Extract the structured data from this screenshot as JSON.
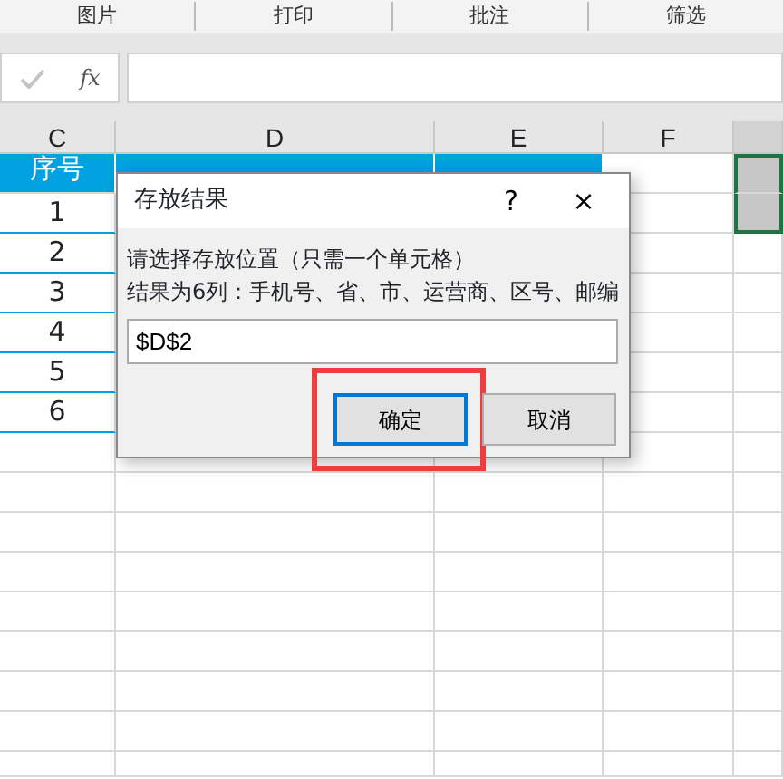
{
  "ribbon": [
    {
      "label": "图片"
    },
    {
      "label": "打印"
    },
    {
      "label": "批注"
    },
    {
      "label": "筛选"
    }
  ],
  "formula_bar": {
    "fx": "fx"
  },
  "columns": [
    {
      "label": "C",
      "selected": false
    },
    {
      "label": "D",
      "selected": false
    },
    {
      "label": "E",
      "selected": false
    },
    {
      "label": "F",
      "selected": false
    },
    {
      "selected": true
    }
  ],
  "rows": [
    {
      "kind": "header",
      "cells": [
        "序号"
      ],
      "selected": true
    },
    {
      "kind": "data",
      "cells": [
        "1"
      ],
      "selected": true
    },
    {
      "kind": "data",
      "cells": [
        "2"
      ],
      "selected": false
    },
    {
      "kind": "data",
      "cells": [
        "3"
      ],
      "selected": false
    },
    {
      "kind": "data",
      "cells": [
        "4"
      ],
      "selected": false
    },
    {
      "kind": "data",
      "cells": [
        "5"
      ],
      "selected": false
    },
    {
      "kind": "data",
      "cells": [
        "6"
      ],
      "selected": false
    },
    {
      "kind": "empty",
      "cells": [],
      "selected": false
    },
    {
      "kind": "empty",
      "cells": [],
      "selected": false
    },
    {
      "kind": "empty",
      "cells": [],
      "selected": false
    },
    {
      "kind": "empty",
      "cells": [],
      "selected": false
    },
    {
      "kind": "empty",
      "cells": [],
      "selected": false
    },
    {
      "kind": "empty",
      "cells": [],
      "selected": false
    },
    {
      "kind": "empty",
      "cells": [],
      "selected": false
    },
    {
      "kind": "empty",
      "cells": [],
      "selected": false
    },
    {
      "kind": "empty",
      "cells": [],
      "selected": false
    }
  ],
  "dialog": {
    "title": "存放结果",
    "help": "?",
    "close": "×",
    "lines": [
      "请选择存放位置（只需一个单元格）",
      "结果为6列：手机号、省、市、运营商、区号、邮编"
    ],
    "input": {
      "value": "$D$2"
    },
    "buttons": [
      {
        "label": "确定",
        "focused": true,
        "highlighted": true
      },
      {
        "label": "取消",
        "focused": false,
        "highlighted": false
      }
    ]
  }
}
